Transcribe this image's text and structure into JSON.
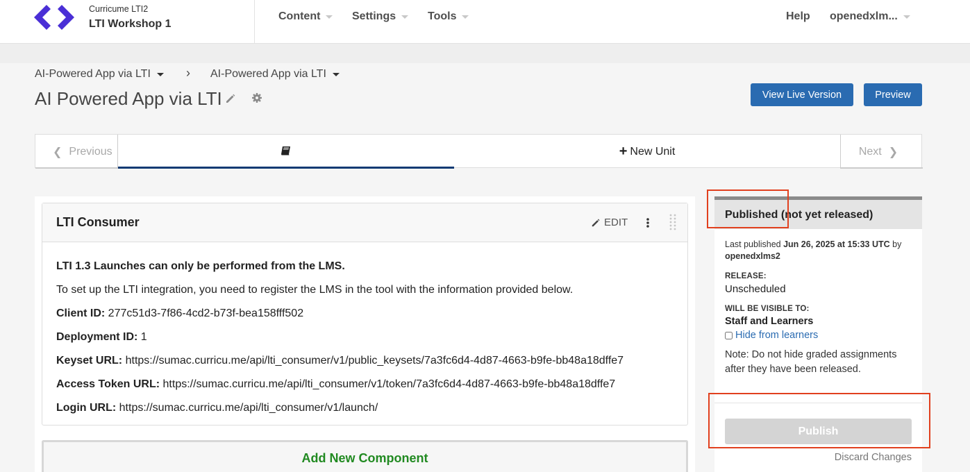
{
  "header": {
    "org": "Curricume  LTI2",
    "course": "LTI Workshop 1",
    "nav": [
      "Content",
      "Settings",
      "Tools"
    ],
    "help": "Help",
    "user": "openedxlm..."
  },
  "breadcrumb": {
    "section": "AI-Powered App via LTI",
    "separator": "›",
    "subsection": "AI-Powered App via LTI"
  },
  "page": {
    "title": "AI Powered App via LTI",
    "view_live": "View Live Version",
    "preview": "Preview"
  },
  "unit_nav": {
    "previous": "Previous",
    "new_unit": "New Unit",
    "next": "Next"
  },
  "component": {
    "title": "LTI Consumer",
    "edit": "EDIT",
    "intro_bold": "LTI 1.3 Launches can only be performed from the LMS.",
    "intro": "To set up the LTI integration, you need to register the LMS in the tool with the information provided below.",
    "fields": [
      {
        "label": "Client ID:",
        "value": "277c51d3-7f86-4cd2-b73f-bea158fff502"
      },
      {
        "label": "Deployment ID:",
        "value": "1"
      },
      {
        "label": "Keyset URL:",
        "value": "https://sumac.curricu.me/api/lti_consumer/v1/public_keysets/7a3fc6d4-4d87-4663-b9fe-bb48a18dffe7"
      },
      {
        "label": "Access Token URL:",
        "value": "https://sumac.curricu.me/api/lti_consumer/v1/token/7a3fc6d4-4d87-4663-b9fe-bb48a18dffe7"
      },
      {
        "label": "Login URL:",
        "value": "https://sumac.curricu.me/api/lti_consumer/v1/launch/"
      }
    ],
    "add_new": "Add New Component"
  },
  "sidebar": {
    "status": "Published (not yet released)",
    "last_published_prefix": "Last published ",
    "last_published_date": "Jun 26, 2025 at 15:33 UTC",
    "last_published_by": " by ",
    "publisher": "openedxlms2",
    "release_label": "RELEASE:",
    "release_value": "Unscheduled",
    "visible_label": "WILL BE VISIBLE TO:",
    "visible_value": "Staff and Learners",
    "hide_link": "Hide from learners",
    "note": "Note: Do not hide graded assignments after they have been released.",
    "publish": "Publish",
    "discard": "Discard Changes"
  },
  "colors": {
    "primary_blue": "#2a6bb1",
    "logo_purple": "#4a2fd6",
    "highlight_red": "#e1401e",
    "add_green": "#218a21"
  }
}
